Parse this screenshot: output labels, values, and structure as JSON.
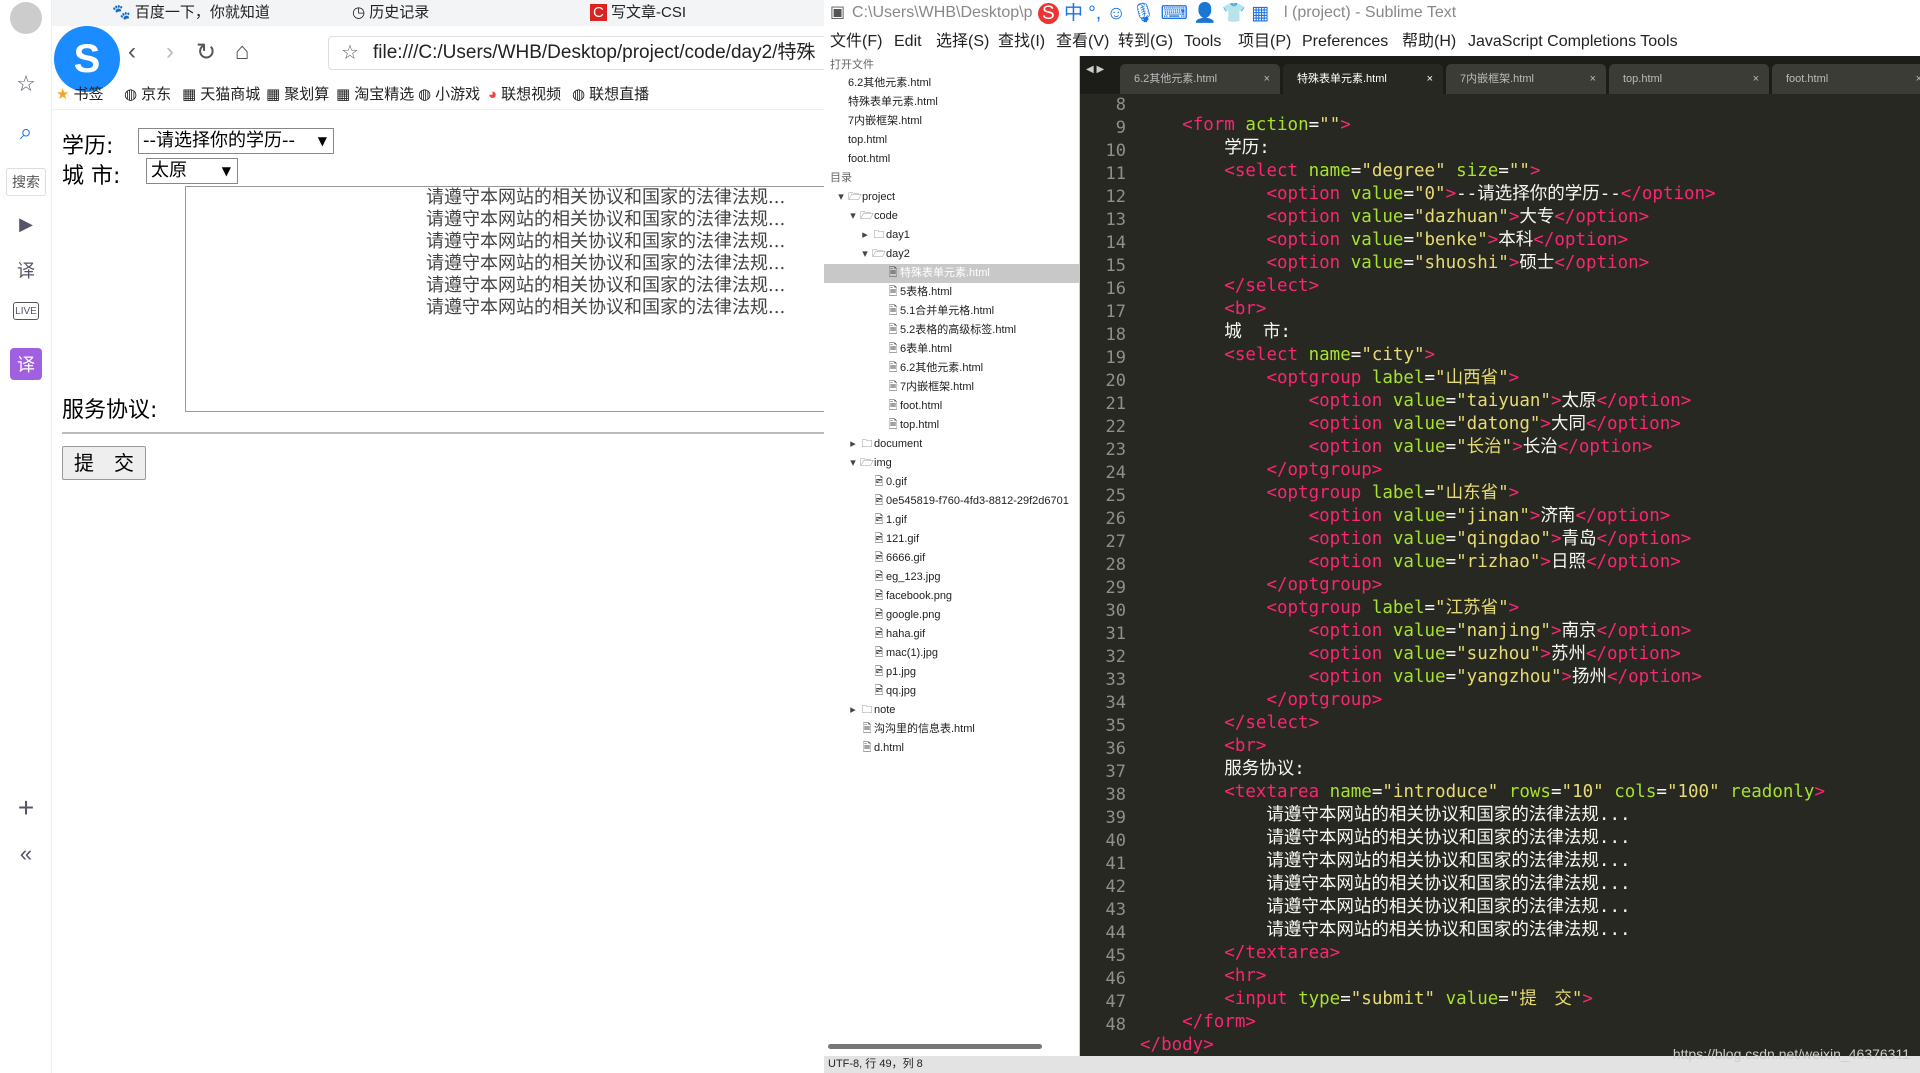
{
  "browser": {
    "tabs": [
      {
        "label": "百度一下，你就知道"
      },
      {
        "label": "历史记录"
      },
      {
        "label": "写文章-CSI"
      }
    ],
    "address": "file:///C:/Users/WHB/Desktop/project/code/day2/特殊",
    "bookmarks": [
      {
        "label": "书签"
      },
      {
        "label": "京东"
      },
      {
        "label": "天猫商城"
      },
      {
        "label": "聚划算"
      },
      {
        "label": "淘宝精选"
      },
      {
        "label": "小游戏"
      },
      {
        "label": "联想视频"
      },
      {
        "label": "联想直播"
      }
    ],
    "sidebar": {
      "search_label": "搜索"
    }
  },
  "form": {
    "degree_label": "学历:",
    "degree_selected": "--请选择你的学历--",
    "city_label": "城 市:",
    "city_selected": "太原",
    "agreement_label": "服务协议:",
    "textarea_lines": [
      "请遵守本网站的相关协议和国家的法律法规...",
      "请遵守本网站的相关协议和国家的法律法规...",
      "请遵守本网站的相关协议和国家的法律法规...",
      "请遵守本网站的相关协议和国家的法律法规...",
      "请遵守本网站的相关协议和国家的法律法规...",
      "请遵守本网站的相关协议和国家的法律法规..."
    ],
    "submit_label": "提　交"
  },
  "editor": {
    "title_left": "C:\\Users\\WHB\\Desktop\\p",
    "title_right": "l (project) - Sublime Text",
    "menu": [
      "文件(F)",
      "Edit",
      "选择(S)",
      "查找(I)",
      "查看(V)",
      "转到(G)",
      "Tools",
      "项目(P)",
      "Preferences",
      "帮助(H)",
      "JavaScript Completions Tools"
    ],
    "tabs": [
      {
        "label": "6.2其他元素.html"
      },
      {
        "label": "特殊表单元素.html"
      },
      {
        "label": "7内嵌框架.html"
      },
      {
        "label": "top.html"
      },
      {
        "label": "foot.html"
      }
    ],
    "open_files_header": "打开文件",
    "open_files": [
      "6.2其他元素.html",
      "特殊表单元素.html",
      "7内嵌框架.html",
      "top.html",
      "foot.html"
    ],
    "folders_header": "目录",
    "tree": [
      {
        "label": "project"
      },
      {
        "label": "code"
      },
      {
        "label": "day1"
      },
      {
        "label": "day2"
      },
      {
        "label": "特殊表单元素.html"
      },
      {
        "label": "5表格.html"
      },
      {
        "label": "5.1合并单元格.html"
      },
      {
        "label": "5.2表格的高级标签.html"
      },
      {
        "label": "6表单.html"
      },
      {
        "label": "6.2其他元素.html"
      },
      {
        "label": "7内嵌框架.html"
      },
      {
        "label": "foot.html"
      },
      {
        "label": "top.html"
      },
      {
        "label": "document"
      },
      {
        "label": "img"
      },
      {
        "label": "0.gif"
      },
      {
        "label": "0e545819-f760-4fd3-8812-29f2d6701"
      },
      {
        "label": "1.gif"
      },
      {
        "label": "121.gif"
      },
      {
        "label": "6666.gif"
      },
      {
        "label": "eg_123.jpg"
      },
      {
        "label": "facebook.png"
      },
      {
        "label": "google.png"
      },
      {
        "label": "haha.gif"
      },
      {
        "label": "mac(1).jpg"
      },
      {
        "label": "p1.jpg"
      },
      {
        "label": "qq.jpg"
      },
      {
        "label": "note"
      },
      {
        "label": "沟沟里的信息表.html"
      },
      {
        "label": "d.html"
      }
    ],
    "line_numbers": [
      "8",
      "9",
      "10",
      "11",
      "12",
      "13",
      "14",
      "15",
      "16",
      "17",
      "18",
      "19",
      "20",
      "21",
      "22",
      "23",
      "24",
      "25",
      "26",
      "27",
      "28",
      "29",
      "30",
      "31",
      "32",
      "33",
      "34",
      "35",
      "36",
      "37",
      "38",
      "39",
      "40",
      "41",
      "42",
      "43",
      "44",
      "45",
      "46",
      "47",
      "48"
    ],
    "status": "UTF-8, 行 49，列 8",
    "watermark": "https://blog.csdn.net/weixin_46376311"
  }
}
